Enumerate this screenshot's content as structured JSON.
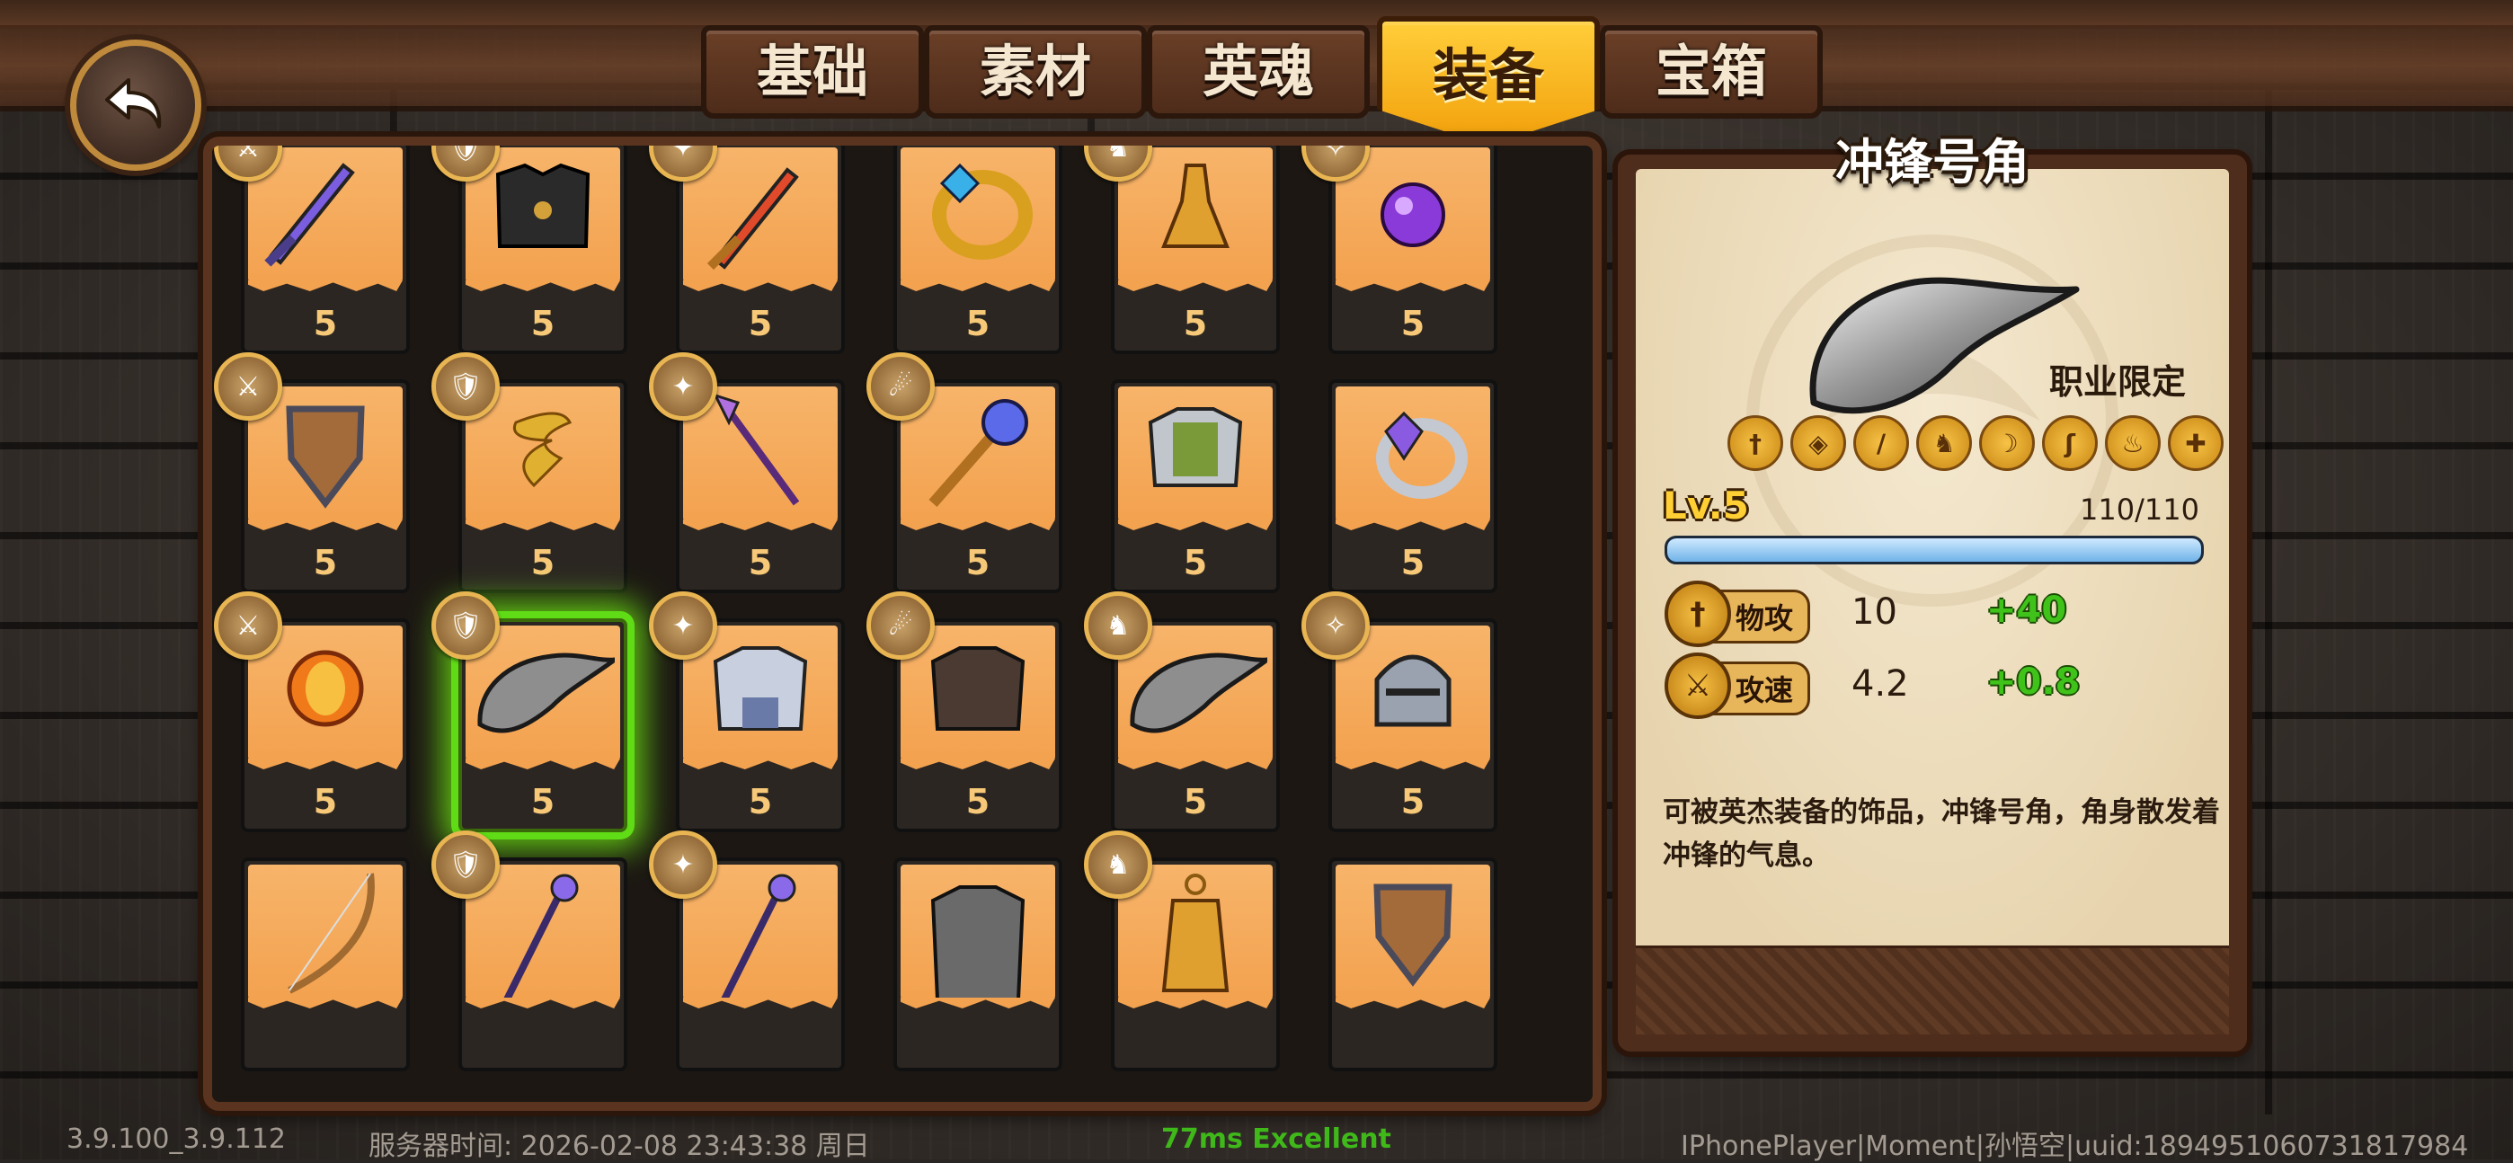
{
  "tabs": [
    {
      "label": "基础",
      "active": false
    },
    {
      "label": "素材",
      "active": false
    },
    {
      "label": "英魂",
      "active": false
    },
    {
      "label": "装备",
      "active": true
    },
    {
      "label": "宝箱",
      "active": false
    }
  ],
  "grid": {
    "rows": [
      [
        {
          "item": "purple-sword",
          "level": "5",
          "hero": "hero-portrait"
        },
        {
          "item": "black-armor",
          "level": "5",
          "hero": "hero-portrait"
        },
        {
          "item": "red-sword",
          "level": "5",
          "hero": "hero-portrait"
        },
        {
          "item": "gold-ring",
          "level": "5",
          "hero": ""
        },
        {
          "item": "golden-bell",
          "level": "5",
          "hero": "hero-portrait"
        },
        {
          "item": "purple-orb",
          "level": "5",
          "hero": "hero-portrait"
        }
      ],
      [
        {
          "item": "wooden-shield",
          "level": "5",
          "hero": "hero-portrait"
        },
        {
          "item": "gold-ribbon",
          "level": "5",
          "hero": "hero-portrait"
        },
        {
          "item": "purple-spear",
          "level": "5",
          "hero": "hero-portrait"
        },
        {
          "item": "orb-staff",
          "level": "5",
          "hero": "hero-portrait"
        },
        {
          "item": "green-armor",
          "level": "5",
          "hero": ""
        },
        {
          "item": "amethyst-ring",
          "level": "5",
          "hero": ""
        }
      ],
      [
        {
          "item": "sun-amulet",
          "level": "5",
          "hero": "hero-portrait"
        },
        {
          "item": "war-horn",
          "level": "5",
          "hero": "hero-portrait",
          "selected": true
        },
        {
          "item": "silver-armor",
          "level": "5",
          "hero": "hero-portrait"
        },
        {
          "item": "leather-armor",
          "level": "5",
          "hero": "hero-portrait"
        },
        {
          "item": "war-horn",
          "level": "5",
          "hero": "hero-portrait"
        },
        {
          "item": "knight-helmet",
          "level": "5",
          "hero": "hero-portrait"
        }
      ],
      [
        {
          "item": "bow",
          "level": "",
          "hero": ""
        },
        {
          "item": "magic-staff",
          "level": "",
          "hero": "hero-portrait"
        },
        {
          "item": "magic-staff",
          "level": "",
          "hero": "hero-portrait"
        },
        {
          "item": "iron-armor",
          "level": "",
          "hero": ""
        },
        {
          "item": "golden-lantern",
          "level": "",
          "hero": "hero-portrait"
        },
        {
          "item": "wooden-shield",
          "level": "",
          "hero": ""
        }
      ]
    ]
  },
  "detail": {
    "title": "冲锋号角",
    "restriction": "职业限定",
    "class_icons": [
      "sword-class-icon",
      "shield-class-icon",
      "spear-class-icon",
      "horse-class-icon",
      "bow-class-icon",
      "beast-class-icon",
      "fire-class-icon",
      "cross-class-icon"
    ],
    "level_label": "Lv.5",
    "xp_text": "110/110",
    "xp_progress": 1.0,
    "stats": [
      {
        "icon": "sword-stat-icon",
        "label": "物攻",
        "value": "10",
        "bonus": "+40"
      },
      {
        "icon": "speed-stat-icon",
        "label": "攻速",
        "value": "4.2",
        "bonus": "+0.8"
      }
    ],
    "description": "可被英杰装备的饰品，冲锋号角，角身散发着冲锋的气息。"
  },
  "footer": {
    "version": "3.9.100_3.9.112",
    "server_time": "服务器时间:  2026-02-08  23:43:38  周日",
    "latency": "77ms Excellent",
    "player": "IPhonePlayer|Moment|孙悟空|uuid:1894951060731817984"
  },
  "colors": {
    "accent": "#f2a10c",
    "selection": "#5fdc16",
    "bonus": "#3fc21a",
    "latency": "#3fb81a"
  }
}
